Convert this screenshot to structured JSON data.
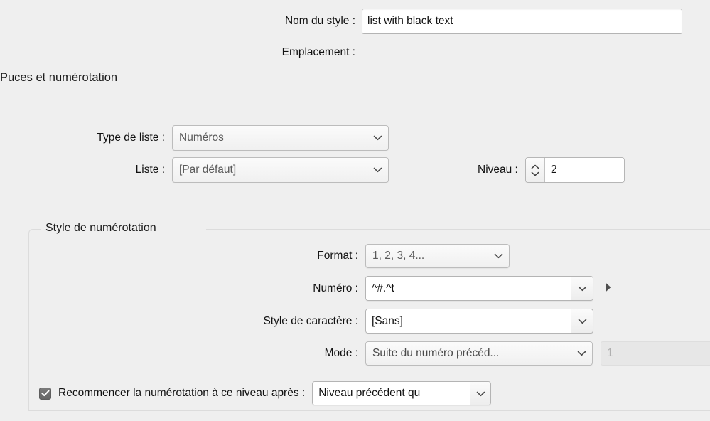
{
  "dialog": {
    "style_name_label": "Nom du style :",
    "style_name_value": "list with black text",
    "style_name_placeholder": "",
    "location_label": "Emplacement :",
    "location_value": ""
  },
  "section": {
    "title": "Puces et numérotation"
  },
  "list_settings": {
    "list_type_label": "Type de liste :",
    "list_type_value": "Numéros",
    "list_label": "Liste :",
    "list_value": "[Par défaut]",
    "level_label": "Niveau :",
    "level_value": "2"
  },
  "numbering_style": {
    "group_label": "Style de numérotation",
    "format_label": "Format :",
    "format_value": "1, 2, 3, 4...",
    "number_label": "Numéro :",
    "number_value": "^#.^t",
    "character_style_label": "Style de caractère :",
    "character_style_value": "[Sans]",
    "mode_label": "Mode :",
    "mode_value": "Suite du numéro précéd...",
    "mode_start_value": "1",
    "restart_checkbox_label": "Recommencer la numérotation à ce niveau après :",
    "restart_checkbox_checked": true,
    "restart_after_value": "Niveau précédent qu"
  },
  "icons": {
    "chevron_down": "chevron-down-icon",
    "stepper_up": "chevron-up-icon",
    "stepper_down": "chevron-down-icon",
    "disclosure_triangle": "disclosure-triangle-icon",
    "checkmark": "checkmark-icon"
  },
  "colors": {
    "window_background": "#efefef",
    "field_background": "#ffffff",
    "border": "#b4b4b4",
    "text": "#1a1a1a",
    "muted_text": "#5a5a5a",
    "disabled_text": "#b0b0b0",
    "checkbox_fill": "#6b6b6b"
  }
}
